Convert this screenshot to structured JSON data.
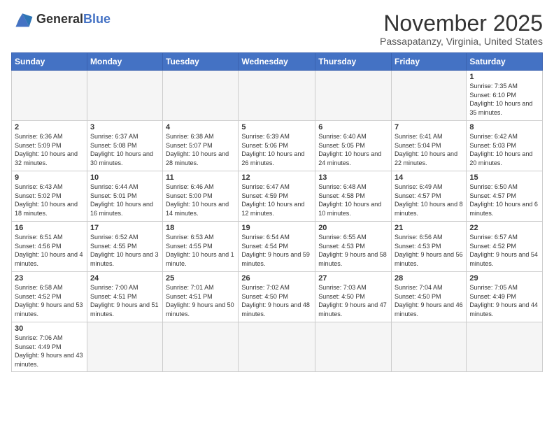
{
  "logo": {
    "text_general": "General",
    "text_blue": "Blue"
  },
  "header": {
    "month": "November 2025",
    "location": "Passapatanzy, Virginia, United States"
  },
  "weekdays": [
    "Sunday",
    "Monday",
    "Tuesday",
    "Wednesday",
    "Thursday",
    "Friday",
    "Saturday"
  ],
  "weeks": [
    [
      {
        "day": "",
        "info": ""
      },
      {
        "day": "",
        "info": ""
      },
      {
        "day": "",
        "info": ""
      },
      {
        "day": "",
        "info": ""
      },
      {
        "day": "",
        "info": ""
      },
      {
        "day": "",
        "info": ""
      },
      {
        "day": "1",
        "info": "Sunrise: 7:35 AM\nSunset: 6:10 PM\nDaylight: 10 hours and 35 minutes."
      }
    ],
    [
      {
        "day": "2",
        "info": "Sunrise: 6:36 AM\nSunset: 5:09 PM\nDaylight: 10 hours and 32 minutes."
      },
      {
        "day": "3",
        "info": "Sunrise: 6:37 AM\nSunset: 5:08 PM\nDaylight: 10 hours and 30 minutes."
      },
      {
        "day": "4",
        "info": "Sunrise: 6:38 AM\nSunset: 5:07 PM\nDaylight: 10 hours and 28 minutes."
      },
      {
        "day": "5",
        "info": "Sunrise: 6:39 AM\nSunset: 5:06 PM\nDaylight: 10 hours and 26 minutes."
      },
      {
        "day": "6",
        "info": "Sunrise: 6:40 AM\nSunset: 5:05 PM\nDaylight: 10 hours and 24 minutes."
      },
      {
        "day": "7",
        "info": "Sunrise: 6:41 AM\nSunset: 5:04 PM\nDaylight: 10 hours and 22 minutes."
      },
      {
        "day": "8",
        "info": "Sunrise: 6:42 AM\nSunset: 5:03 PM\nDaylight: 10 hours and 20 minutes."
      }
    ],
    [
      {
        "day": "9",
        "info": "Sunrise: 6:43 AM\nSunset: 5:02 PM\nDaylight: 10 hours and 18 minutes."
      },
      {
        "day": "10",
        "info": "Sunrise: 6:44 AM\nSunset: 5:01 PM\nDaylight: 10 hours and 16 minutes."
      },
      {
        "day": "11",
        "info": "Sunrise: 6:46 AM\nSunset: 5:00 PM\nDaylight: 10 hours and 14 minutes."
      },
      {
        "day": "12",
        "info": "Sunrise: 6:47 AM\nSunset: 4:59 PM\nDaylight: 10 hours and 12 minutes."
      },
      {
        "day": "13",
        "info": "Sunrise: 6:48 AM\nSunset: 4:58 PM\nDaylight: 10 hours and 10 minutes."
      },
      {
        "day": "14",
        "info": "Sunrise: 6:49 AM\nSunset: 4:57 PM\nDaylight: 10 hours and 8 minutes."
      },
      {
        "day": "15",
        "info": "Sunrise: 6:50 AM\nSunset: 4:57 PM\nDaylight: 10 hours and 6 minutes."
      }
    ],
    [
      {
        "day": "16",
        "info": "Sunrise: 6:51 AM\nSunset: 4:56 PM\nDaylight: 10 hours and 4 minutes."
      },
      {
        "day": "17",
        "info": "Sunrise: 6:52 AM\nSunset: 4:55 PM\nDaylight: 10 hours and 3 minutes."
      },
      {
        "day": "18",
        "info": "Sunrise: 6:53 AM\nSunset: 4:55 PM\nDaylight: 10 hours and 1 minute."
      },
      {
        "day": "19",
        "info": "Sunrise: 6:54 AM\nSunset: 4:54 PM\nDaylight: 9 hours and 59 minutes."
      },
      {
        "day": "20",
        "info": "Sunrise: 6:55 AM\nSunset: 4:53 PM\nDaylight: 9 hours and 58 minutes."
      },
      {
        "day": "21",
        "info": "Sunrise: 6:56 AM\nSunset: 4:53 PM\nDaylight: 9 hours and 56 minutes."
      },
      {
        "day": "22",
        "info": "Sunrise: 6:57 AM\nSunset: 4:52 PM\nDaylight: 9 hours and 54 minutes."
      }
    ],
    [
      {
        "day": "23",
        "info": "Sunrise: 6:58 AM\nSunset: 4:52 PM\nDaylight: 9 hours and 53 minutes."
      },
      {
        "day": "24",
        "info": "Sunrise: 7:00 AM\nSunset: 4:51 PM\nDaylight: 9 hours and 51 minutes."
      },
      {
        "day": "25",
        "info": "Sunrise: 7:01 AM\nSunset: 4:51 PM\nDaylight: 9 hours and 50 minutes."
      },
      {
        "day": "26",
        "info": "Sunrise: 7:02 AM\nSunset: 4:50 PM\nDaylight: 9 hours and 48 minutes."
      },
      {
        "day": "27",
        "info": "Sunrise: 7:03 AM\nSunset: 4:50 PM\nDaylight: 9 hours and 47 minutes."
      },
      {
        "day": "28",
        "info": "Sunrise: 7:04 AM\nSunset: 4:50 PM\nDaylight: 9 hours and 46 minutes."
      },
      {
        "day": "29",
        "info": "Sunrise: 7:05 AM\nSunset: 4:49 PM\nDaylight: 9 hours and 44 minutes."
      }
    ],
    [
      {
        "day": "30",
        "info": "Sunrise: 7:06 AM\nSunset: 4:49 PM\nDaylight: 9 hours and 43 minutes."
      },
      {
        "day": "",
        "info": ""
      },
      {
        "day": "",
        "info": ""
      },
      {
        "day": "",
        "info": ""
      },
      {
        "day": "",
        "info": ""
      },
      {
        "day": "",
        "info": ""
      },
      {
        "day": "",
        "info": ""
      }
    ]
  ]
}
